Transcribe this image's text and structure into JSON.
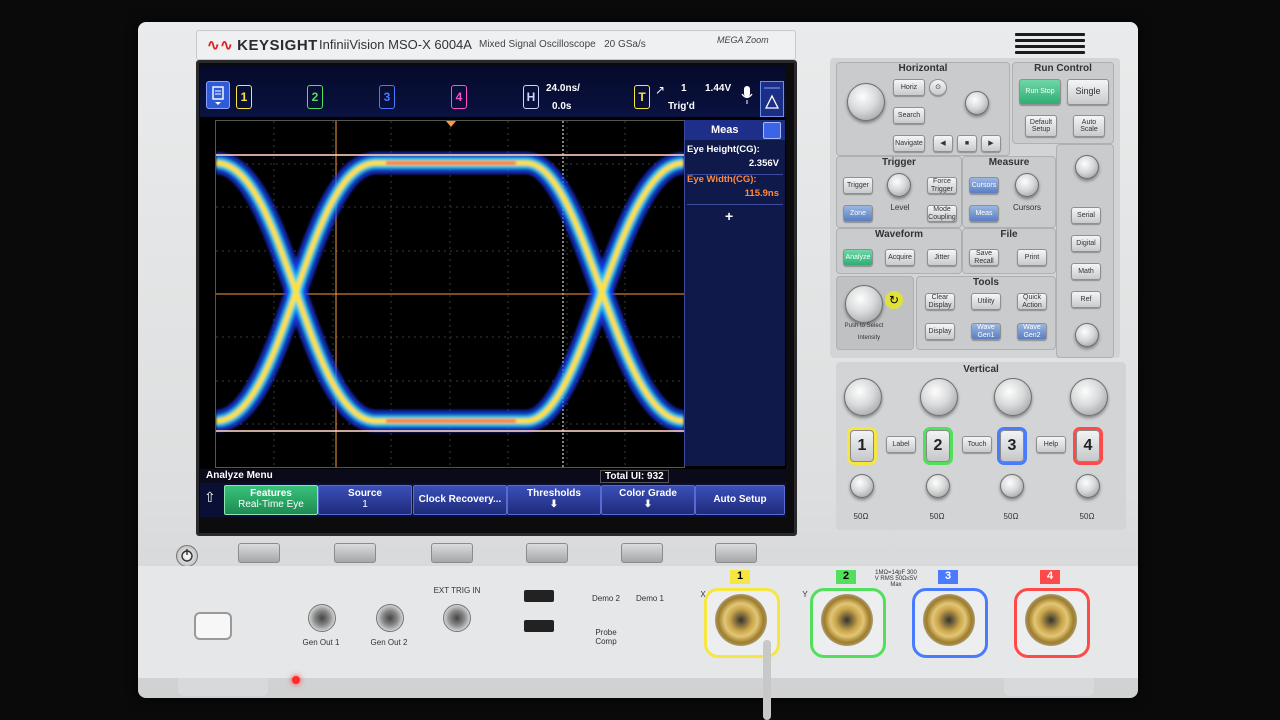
{
  "brand": {
    "logo": "KEYSIGHT",
    "model": "InfiniiVision MSO-X 6004A",
    "description": "Mixed Signal Oscilloscope",
    "rate": "20 GSa/s",
    "megazoom": "MEGA Zoom"
  },
  "toolbar": {
    "channels": [
      {
        "num": "1",
        "color": "#f5e642"
      },
      {
        "num": "2",
        "color": "#52e05c"
      },
      {
        "num": "3",
        "color": "#4a7bff"
      },
      {
        "num": "4",
        "color": "#ff4fd1"
      }
    ],
    "horizontal": {
      "label": "H",
      "timebase": "24.0ns/",
      "delay": "0.0s"
    },
    "trigger": {
      "label": "T",
      "source": "1",
      "level": "1.44V",
      "status": "Trig'd"
    }
  },
  "meas": {
    "title": "Meas",
    "items": [
      {
        "label": "Eye Height(CG):",
        "value": "2.356V",
        "color": "#ffffff"
      },
      {
        "label": "Eye Width(CG):",
        "value": "115.9ns",
        "color": "#ff8a3c"
      }
    ],
    "add": "+"
  },
  "status": {
    "menu": "Analyze Menu",
    "total_ui": "Total UI: 932"
  },
  "softkeys": [
    {
      "label": "Features",
      "sub": "Real-Time Eye"
    },
    {
      "label": "Source",
      "sub": "1"
    },
    {
      "label": "Clock Recovery...",
      "sub": ""
    },
    {
      "label": "Thresholds",
      "sub": ""
    },
    {
      "label": "Color Grade",
      "sub": ""
    },
    {
      "label": "Auto Setup",
      "sub": ""
    }
  ],
  "panel": {
    "horizontal": "Horizontal",
    "horiz_btn": "Horiz",
    "search_btn": "Search",
    "navigate_btn": "Navigate",
    "run_control": "Run Control",
    "run_btn": "Run Stop",
    "single_btn": "Single",
    "default_setup": "Default Setup",
    "auto_scale": "Auto Scale",
    "trigger": "Trigger",
    "trigger_btn": "Trigger",
    "force_trigger": "Force Trigger",
    "zone_btn": "Zone",
    "level": "Level",
    "mode_coupling": "Mode Coupling",
    "measure": "Measure",
    "cursors_btn": "Cursors",
    "meas_btn": "Meas",
    "cursors": "Cursors",
    "waveform": "Waveform",
    "analyze_btn": "Analyze",
    "acquire_btn": "Acquire",
    "jitter_btn": "Jitter",
    "file": "File",
    "save_recall": "Save Recall",
    "print_btn": "Print",
    "tools": "Tools",
    "clear_display": "Clear Display",
    "utility_btn": "Utility",
    "quick_action": "Quick Action",
    "display_btn": "Display",
    "wave_gen1": "Wave Gen1",
    "wave_gen2": "Wave Gen2",
    "push_to_select": "Push to Select",
    "intensity": "Intensity",
    "serial_btn": "Serial",
    "digital_btn": "Digital",
    "math_btn": "Math",
    "ref_btn": "Ref",
    "vertical": "Vertical",
    "label_btn": "Label",
    "touch_btn": "Touch",
    "help_btn": "Help",
    "impedance": "50Ω"
  },
  "front": {
    "gen_out1": "Gen Out 1",
    "gen_out2": "Gen Out 2",
    "ext_trig": "EXT TRIG IN",
    "demo2": "Demo 2",
    "demo1": "Demo 1",
    "probe_comp": "Probe Comp",
    "x_label": "X",
    "y_label": "Y",
    "rating": "1MΩ=14pF 300 V RMS 50Ω≤5V Max"
  }
}
